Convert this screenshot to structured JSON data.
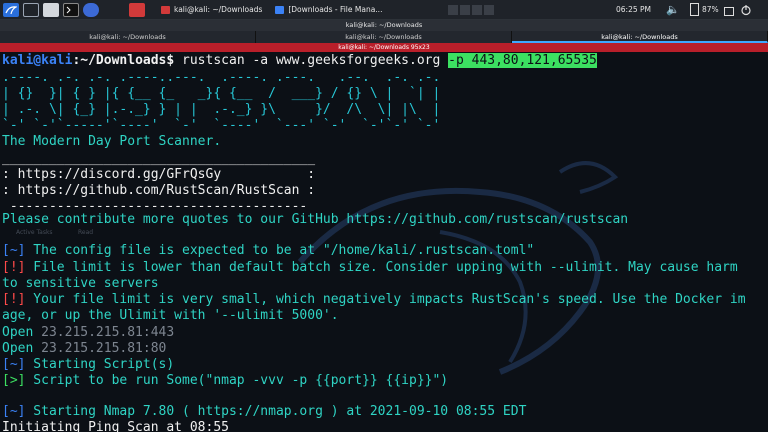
{
  "panel": {
    "tasks": [
      {
        "label": "kali@kali: ~/Downloads",
        "active": false
      },
      {
        "label": "[Downloads - File Mana...",
        "active": false
      }
    ],
    "clock": "06:25 PM",
    "battery": "87%"
  },
  "window": {
    "title": "kali@kali: ~/Downloads",
    "tabs": [
      "kali@kali: ~/Downloads",
      "kali@kali: ~/Downloads",
      "kali@kali: ~/Downloads"
    ],
    "subtitle": "kali@kali: ~/Downloads 95x23"
  },
  "desktop_labels": [
    "Active Tasks",
    "Read"
  ],
  "terminal": {
    "prompt_user": "kali@kali",
    "prompt_path": ":~/Downloads$",
    "command": " rustscan -a www.geeksforgeeks.org ",
    "command_flag": "-p 443,80,121,65535",
    "banner_lines": [
      ".----. .-. .-. .----..---.  .----. .---.   .--.  .-. .-.",
      "| {}  }| { } |{ {__ {_   _}{ {__  /  ___} / {} \\ |  `| |",
      "| .-. \\| {_} |.-._} } | |  .-._} }\\     }/  /\\  \\| |\\  |",
      "`-' `-'`-----'`----'  `-'  `----'  `---' `-'  `-'`-' `-'"
    ],
    "tagline": "The Modern Day Port Scanner.",
    "sep1": "________________________________________",
    "discord": ": https://discord.gg/GFrQsGy           :",
    "github": ": https://github.com/RustScan/RustScan :",
    "sep2": " --------------------------------------",
    "contribute": "Please contribute more quotes to our GitHub https://github.com/rustscan/rustscan",
    "l1_tag": "[~]",
    "l1": " The config file is expected to be at \"/home/kali/.rustscan.toml\"",
    "l2_tag": "[!]",
    "l2a": " File limit is lower than default batch size. Consider upping with --ulimit. May cause harm",
    "l2b": "to sensitive servers",
    "l3_tag": "[!]",
    "l3a": " Your file limit is very small, which negatively impacts RustScan's speed. Use the Docker im",
    "l3b": "age, or up the Ulimit with '--ulimit 5000'.",
    "open1_label": "Open ",
    "open1_addr": "23.215.215.81:443",
    "open2_label": "Open ",
    "open2_addr": "23.215.215.81:80",
    "l4_tag": "[~]",
    "l4": " Starting Script(s)",
    "l5_tag": "[>]",
    "l5": " Script to be run Some(\"nmap -vvv -p {{port}} {{ip}}\")",
    "l6_tag": "[~]",
    "l6": " Starting Nmap 7.80 ( https://nmap.org ) at 2021-09-10 08:55 EDT",
    "l7": "Initiating Ping Scan at 08:55"
  }
}
